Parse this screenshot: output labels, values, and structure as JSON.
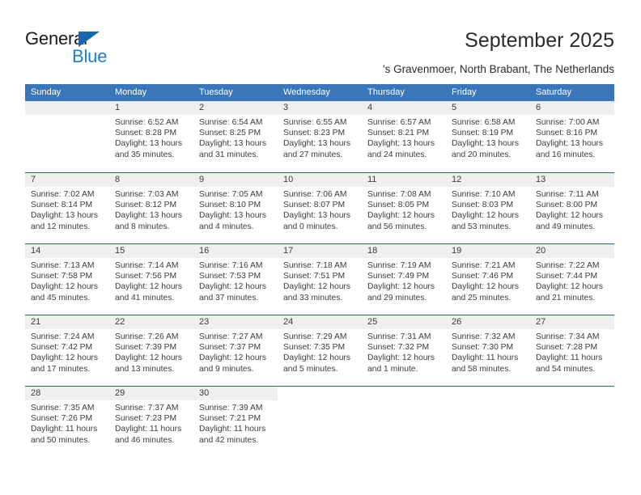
{
  "brand": {
    "name_top": "General",
    "name_bottom": "Blue",
    "triangle_color": "#1567b0",
    "blue_color": "#1a7fd4"
  },
  "header": {
    "title": "September 2025",
    "subtitle": "'s Gravenmoer, North Brabant, The Netherlands"
  },
  "theme": {
    "header_blue": "#3a76b8",
    "row_divider_blue": "#1e5fa2",
    "day_number_band": "#efefef",
    "text": "#3b3b3b"
  },
  "calendar": {
    "weekday_headers": [
      "Sunday",
      "Monday",
      "Tuesday",
      "Wednesday",
      "Thursday",
      "Friday",
      "Saturday"
    ],
    "weeks": [
      [
        {
          "day": "",
          "empty": true,
          "sunrise": "",
          "sunset": "",
          "daylight_line1": "",
          "daylight_line2": ""
        },
        {
          "day": "1",
          "sunrise": "Sunrise: 6:52 AM",
          "sunset": "Sunset: 8:28 PM",
          "daylight_line1": "Daylight: 13 hours",
          "daylight_line2": "and 35 minutes."
        },
        {
          "day": "2",
          "sunrise": "Sunrise: 6:54 AM",
          "sunset": "Sunset: 8:25 PM",
          "daylight_line1": "Daylight: 13 hours",
          "daylight_line2": "and 31 minutes."
        },
        {
          "day": "3",
          "sunrise": "Sunrise: 6:55 AM",
          "sunset": "Sunset: 8:23 PM",
          "daylight_line1": "Daylight: 13 hours",
          "daylight_line2": "and 27 minutes."
        },
        {
          "day": "4",
          "sunrise": "Sunrise: 6:57 AM",
          "sunset": "Sunset: 8:21 PM",
          "daylight_line1": "Daylight: 13 hours",
          "daylight_line2": "and 24 minutes."
        },
        {
          "day": "5",
          "sunrise": "Sunrise: 6:58 AM",
          "sunset": "Sunset: 8:19 PM",
          "daylight_line1": "Daylight: 13 hours",
          "daylight_line2": "and 20 minutes."
        },
        {
          "day": "6",
          "sunrise": "Sunrise: 7:00 AM",
          "sunset": "Sunset: 8:16 PM",
          "daylight_line1": "Daylight: 13 hours",
          "daylight_line2": "and 16 minutes."
        }
      ],
      [
        {
          "day": "7",
          "sunrise": "Sunrise: 7:02 AM",
          "sunset": "Sunset: 8:14 PM",
          "daylight_line1": "Daylight: 13 hours",
          "daylight_line2": "and 12 minutes."
        },
        {
          "day": "8",
          "sunrise": "Sunrise: 7:03 AM",
          "sunset": "Sunset: 8:12 PM",
          "daylight_line1": "Daylight: 13 hours",
          "daylight_line2": "and 8 minutes."
        },
        {
          "day": "9",
          "sunrise": "Sunrise: 7:05 AM",
          "sunset": "Sunset: 8:10 PM",
          "daylight_line1": "Daylight: 13 hours",
          "daylight_line2": "and 4 minutes."
        },
        {
          "day": "10",
          "sunrise": "Sunrise: 7:06 AM",
          "sunset": "Sunset: 8:07 PM",
          "daylight_line1": "Daylight: 13 hours",
          "daylight_line2": "and 0 minutes."
        },
        {
          "day": "11",
          "sunrise": "Sunrise: 7:08 AM",
          "sunset": "Sunset: 8:05 PM",
          "daylight_line1": "Daylight: 12 hours",
          "daylight_line2": "and 56 minutes."
        },
        {
          "day": "12",
          "sunrise": "Sunrise: 7:10 AM",
          "sunset": "Sunset: 8:03 PM",
          "daylight_line1": "Daylight: 12 hours",
          "daylight_line2": "and 53 minutes."
        },
        {
          "day": "13",
          "sunrise": "Sunrise: 7:11 AM",
          "sunset": "Sunset: 8:00 PM",
          "daylight_line1": "Daylight: 12 hours",
          "daylight_line2": "and 49 minutes."
        }
      ],
      [
        {
          "day": "14",
          "sunrise": "Sunrise: 7:13 AM",
          "sunset": "Sunset: 7:58 PM",
          "daylight_line1": "Daylight: 12 hours",
          "daylight_line2": "and 45 minutes."
        },
        {
          "day": "15",
          "sunrise": "Sunrise: 7:14 AM",
          "sunset": "Sunset: 7:56 PM",
          "daylight_line1": "Daylight: 12 hours",
          "daylight_line2": "and 41 minutes."
        },
        {
          "day": "16",
          "sunrise": "Sunrise: 7:16 AM",
          "sunset": "Sunset: 7:53 PM",
          "daylight_line1": "Daylight: 12 hours",
          "daylight_line2": "and 37 minutes."
        },
        {
          "day": "17",
          "sunrise": "Sunrise: 7:18 AM",
          "sunset": "Sunset: 7:51 PM",
          "daylight_line1": "Daylight: 12 hours",
          "daylight_line2": "and 33 minutes."
        },
        {
          "day": "18",
          "sunrise": "Sunrise: 7:19 AM",
          "sunset": "Sunset: 7:49 PM",
          "daylight_line1": "Daylight: 12 hours",
          "daylight_line2": "and 29 minutes."
        },
        {
          "day": "19",
          "sunrise": "Sunrise: 7:21 AM",
          "sunset": "Sunset: 7:46 PM",
          "daylight_line1": "Daylight: 12 hours",
          "daylight_line2": "and 25 minutes."
        },
        {
          "day": "20",
          "sunrise": "Sunrise: 7:22 AM",
          "sunset": "Sunset: 7:44 PM",
          "daylight_line1": "Daylight: 12 hours",
          "daylight_line2": "and 21 minutes."
        }
      ],
      [
        {
          "day": "21",
          "sunrise": "Sunrise: 7:24 AM",
          "sunset": "Sunset: 7:42 PM",
          "daylight_line1": "Daylight: 12 hours",
          "daylight_line2": "and 17 minutes."
        },
        {
          "day": "22",
          "sunrise": "Sunrise: 7:26 AM",
          "sunset": "Sunset: 7:39 PM",
          "daylight_line1": "Daylight: 12 hours",
          "daylight_line2": "and 13 minutes."
        },
        {
          "day": "23",
          "sunrise": "Sunrise: 7:27 AM",
          "sunset": "Sunset: 7:37 PM",
          "daylight_line1": "Daylight: 12 hours",
          "daylight_line2": "and 9 minutes."
        },
        {
          "day": "24",
          "sunrise": "Sunrise: 7:29 AM",
          "sunset": "Sunset: 7:35 PM",
          "daylight_line1": "Daylight: 12 hours",
          "daylight_line2": "and 5 minutes."
        },
        {
          "day": "25",
          "sunrise": "Sunrise: 7:31 AM",
          "sunset": "Sunset: 7:32 PM",
          "daylight_line1": "Daylight: 12 hours",
          "daylight_line2": "and 1 minute."
        },
        {
          "day": "26",
          "sunrise": "Sunrise: 7:32 AM",
          "sunset": "Sunset: 7:30 PM",
          "daylight_line1": "Daylight: 11 hours",
          "daylight_line2": "and 58 minutes."
        },
        {
          "day": "27",
          "sunrise": "Sunrise: 7:34 AM",
          "sunset": "Sunset: 7:28 PM",
          "daylight_line1": "Daylight: 11 hours",
          "daylight_line2": "and 54 minutes."
        }
      ],
      [
        {
          "day": "28",
          "sunrise": "Sunrise: 7:35 AM",
          "sunset": "Sunset: 7:26 PM",
          "daylight_line1": "Daylight: 11 hours",
          "daylight_line2": "and 50 minutes."
        },
        {
          "day": "29",
          "sunrise": "Sunrise: 7:37 AM",
          "sunset": "Sunset: 7:23 PM",
          "daylight_line1": "Daylight: 11 hours",
          "daylight_line2": "and 46 minutes."
        },
        {
          "day": "30",
          "sunrise": "Sunrise: 7:39 AM",
          "sunset": "Sunset: 7:21 PM",
          "daylight_line1": "Daylight: 11 hours",
          "daylight_line2": "and 42 minutes."
        },
        {
          "day": "",
          "blank": true,
          "sunrise": "",
          "sunset": "",
          "daylight_line1": "",
          "daylight_line2": ""
        },
        {
          "day": "",
          "blank": true,
          "sunrise": "",
          "sunset": "",
          "daylight_line1": "",
          "daylight_line2": ""
        },
        {
          "day": "",
          "blank": true,
          "sunrise": "",
          "sunset": "",
          "daylight_line1": "",
          "daylight_line2": ""
        },
        {
          "day": "",
          "blank": true,
          "sunrise": "",
          "sunset": "",
          "daylight_line1": "",
          "daylight_line2": ""
        }
      ]
    ]
  }
}
